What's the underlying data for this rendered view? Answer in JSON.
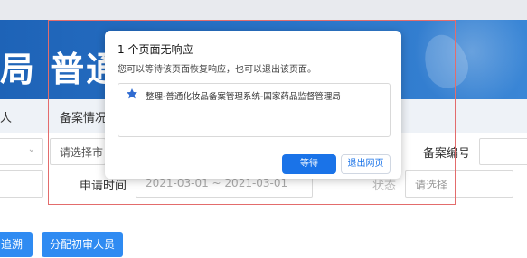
{
  "banner": {
    "title": "局 普通化"
  },
  "tabs": [
    {
      "label": "人"
    },
    {
      "label": "备案情况"
    }
  ],
  "filters": {
    "select_city_placeholder": "请选择市",
    "record_no_label": "备案编号",
    "apply_time_label": "申请时间",
    "date_range_value": "2021-03-01 ~ 2021-03-01",
    "status_label": "状态",
    "status_placeholder": "请选择"
  },
  "actions": {
    "trace_button": "追溯",
    "assign_button": "分配初审人员"
  },
  "dialog": {
    "title": "1 个页面无响应",
    "description": "您可以等待该页面恢复响应，也可以退出该页面。",
    "item_text": "整理-普通化妆品备案管理系统-国家药品监督管理局",
    "wait_button": "等待",
    "exit_button": "退出网页"
  },
  "colors": {
    "banner_blue": "#1e63b7",
    "primary_button": "#2f8bf2",
    "dialog_primary": "#1a73e8",
    "highlight_rect": "#e36c6c"
  }
}
